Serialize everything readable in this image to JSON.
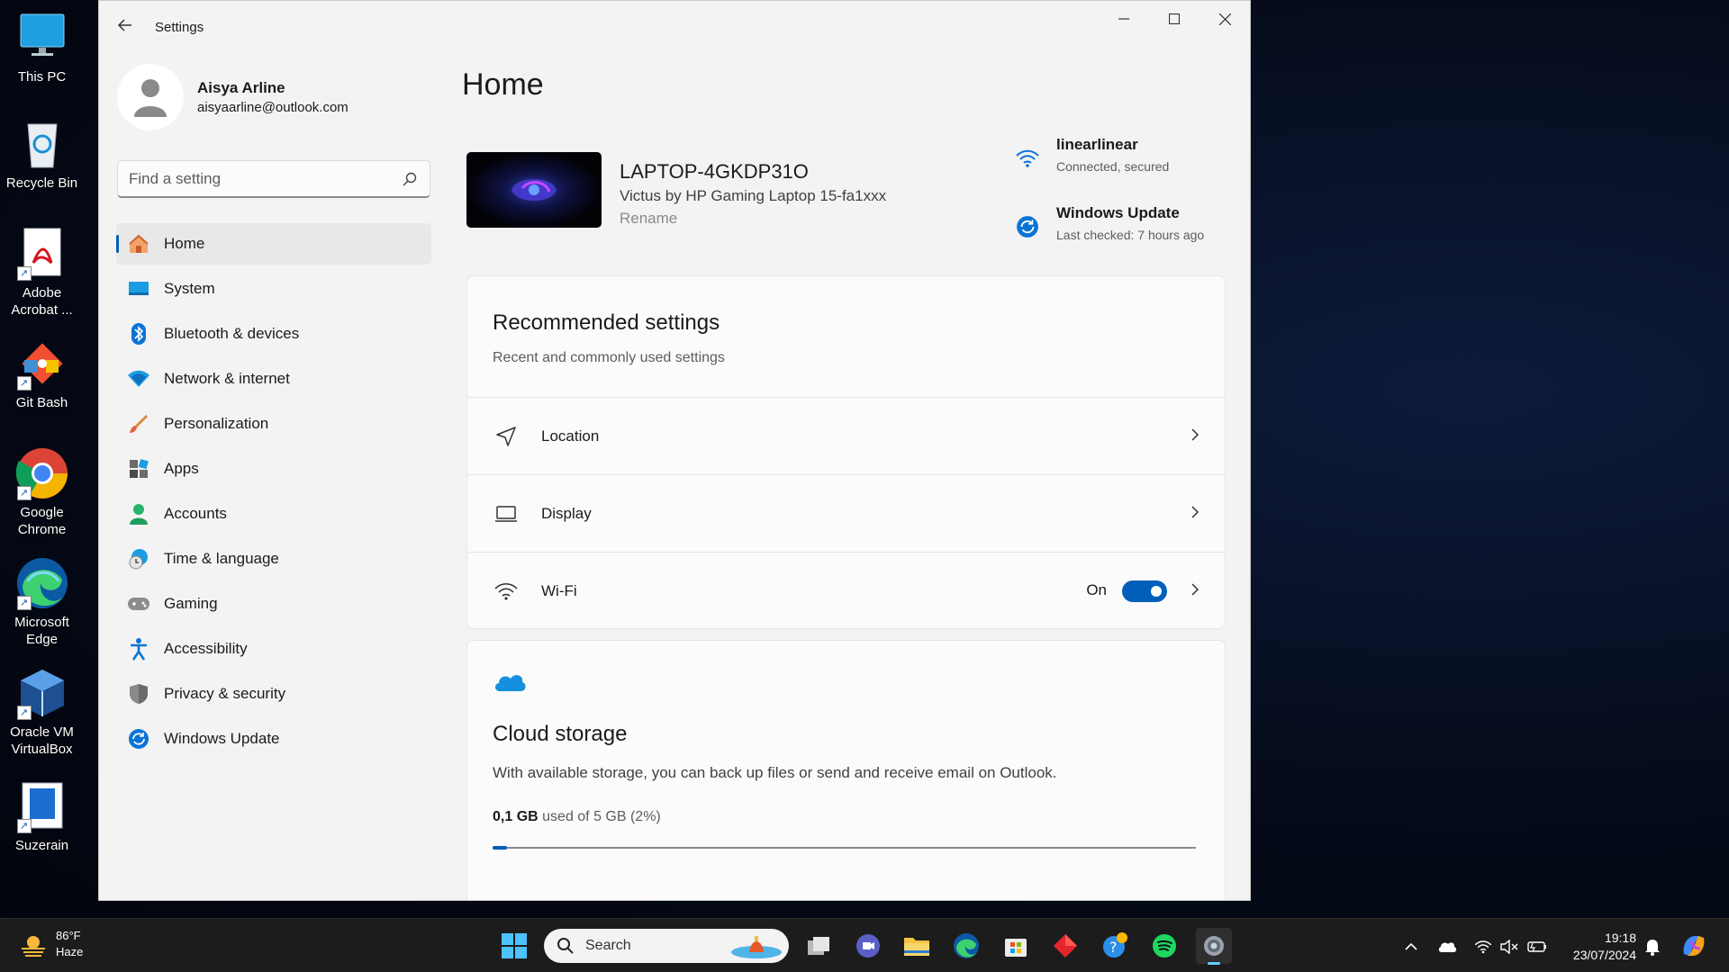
{
  "desktop": {
    "icons": [
      {
        "label": "This PC"
      },
      {
        "label": "Recycle Bin"
      },
      {
        "label": "Adobe Acrobat ..."
      },
      {
        "label": "Git Bash"
      },
      {
        "label": "Google Chrome"
      },
      {
        "label": "Microsoft Edge"
      },
      {
        "label": "Oracle VM VirtualBox"
      },
      {
        "label": "Suzerain"
      }
    ]
  },
  "window": {
    "title": "Settings"
  },
  "profile": {
    "name": "Aisya Arline",
    "email": "aisyaarline@outlook.com"
  },
  "search": {
    "placeholder": "Find a setting"
  },
  "nav": {
    "items": [
      {
        "label": "Home",
        "icon": "home-icon",
        "active": true
      },
      {
        "label": "System",
        "icon": "system-icon"
      },
      {
        "label": "Bluetooth & devices",
        "icon": "bluetooth-icon"
      },
      {
        "label": "Network & internet",
        "icon": "network-icon"
      },
      {
        "label": "Personalization",
        "icon": "brush-icon"
      },
      {
        "label": "Apps",
        "icon": "apps-icon"
      },
      {
        "label": "Accounts",
        "icon": "accounts-icon"
      },
      {
        "label": "Time & language",
        "icon": "clock-globe-icon"
      },
      {
        "label": "Gaming",
        "icon": "gamepad-icon"
      },
      {
        "label": "Accessibility",
        "icon": "accessibility-icon"
      },
      {
        "label": "Privacy & security",
        "icon": "shield-icon"
      },
      {
        "label": "Windows Update",
        "icon": "update-icon"
      }
    ]
  },
  "main": {
    "title": "Home",
    "device": {
      "name": "LAPTOP-4GKDP31O",
      "model": "Victus by HP Gaming Laptop 15-fa1xxx",
      "rename": "Rename"
    },
    "status": {
      "wifi": {
        "title": "linearlinear",
        "subtitle": "Connected, secured"
      },
      "update": {
        "title": "Windows Update",
        "subtitle": "Last checked: 7 hours ago"
      }
    },
    "recommended": {
      "title": "Recommended settings",
      "subtitle": "Recent and commonly used settings",
      "rows": [
        {
          "label": "Location",
          "icon": "location-icon"
        },
        {
          "label": "Display",
          "icon": "laptop-icon"
        },
        {
          "label": "Wi-Fi",
          "icon": "wifi-icon",
          "toggle_label": "On",
          "toggle_on": true
        }
      ]
    },
    "cloud": {
      "title": "Cloud storage",
      "description": "With available storage, you can back up files or send and receive email on Outlook.",
      "used": "0,1 GB",
      "of_total": "used of 5 GB (2%)",
      "used_fraction": 0.02
    }
  },
  "taskbar": {
    "weather": {
      "temp": "86°F",
      "condition": "Haze"
    },
    "search_label": "Search",
    "clock": {
      "time": "19:18",
      "date": "23/07/2024"
    }
  },
  "colors": {
    "accent": "#005fb8",
    "window_bg": "#f3f3f3",
    "card_bg": "#fbfbfb",
    "taskbar_bg": "#1c1c1c"
  }
}
